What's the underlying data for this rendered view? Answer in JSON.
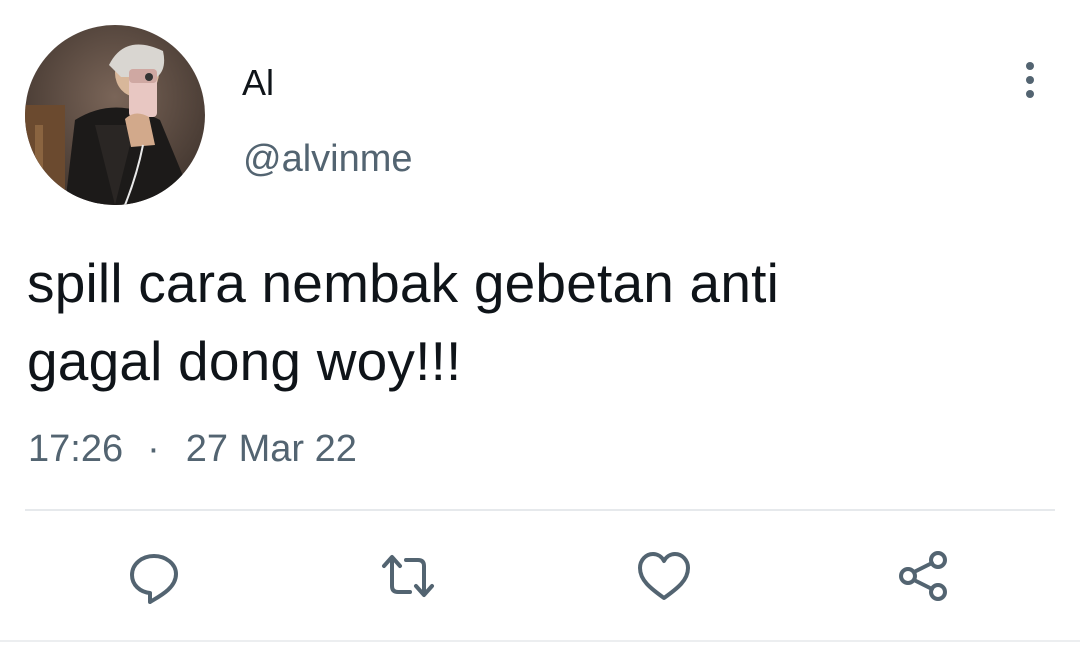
{
  "author": {
    "display_name": "Al",
    "handle": "@alvinme",
    "avatar_icon": "profile-photo"
  },
  "tweet": {
    "text": "spill cara nembak gebetan anti\ngagal dong woy!!!",
    "time": "17:26",
    "separator": "·",
    "date": "27 Mar 22"
  },
  "icons": {
    "more": "more-vertical-icon",
    "reply": "reply-icon",
    "retweet": "retweet-icon",
    "like": "heart-icon",
    "share": "share-icon"
  },
  "colors": {
    "text_primary": "#0f1419",
    "text_secondary": "#536471",
    "icon": "#536471",
    "divider": "#e6e9ec"
  }
}
